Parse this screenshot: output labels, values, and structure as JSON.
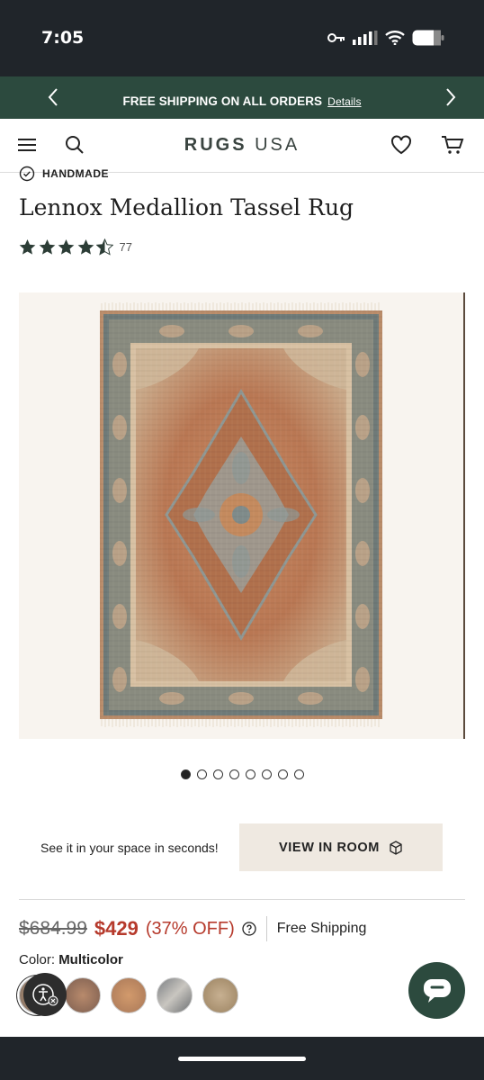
{
  "status_bar": {
    "time": "7:05"
  },
  "promo": {
    "text": "FREE SHIPPING ON ALL ORDERS",
    "link": "Details"
  },
  "header": {
    "logo_bold": "RUGS",
    "logo_light": "USA"
  },
  "product": {
    "badge": "HANDMADE",
    "title": "Lennox Medallion Tassel Rug",
    "rating": 4.5,
    "review_count": "77",
    "image_count": 8,
    "active_image": 1
  },
  "view_in_room": {
    "prompt": "See it in your space in seconds!",
    "button_label": "VIEW IN ROOM"
  },
  "pricing": {
    "original_price": "$684.99",
    "sale_price": "$429",
    "discount": "(37% OFF)",
    "shipping": "Free Shipping"
  },
  "color": {
    "label": "Color:",
    "value": "Multicolor"
  },
  "colors": {
    "accent": "#2c4a3e",
    "sale": "#b63a2c",
    "status_bar": "#20252a"
  }
}
